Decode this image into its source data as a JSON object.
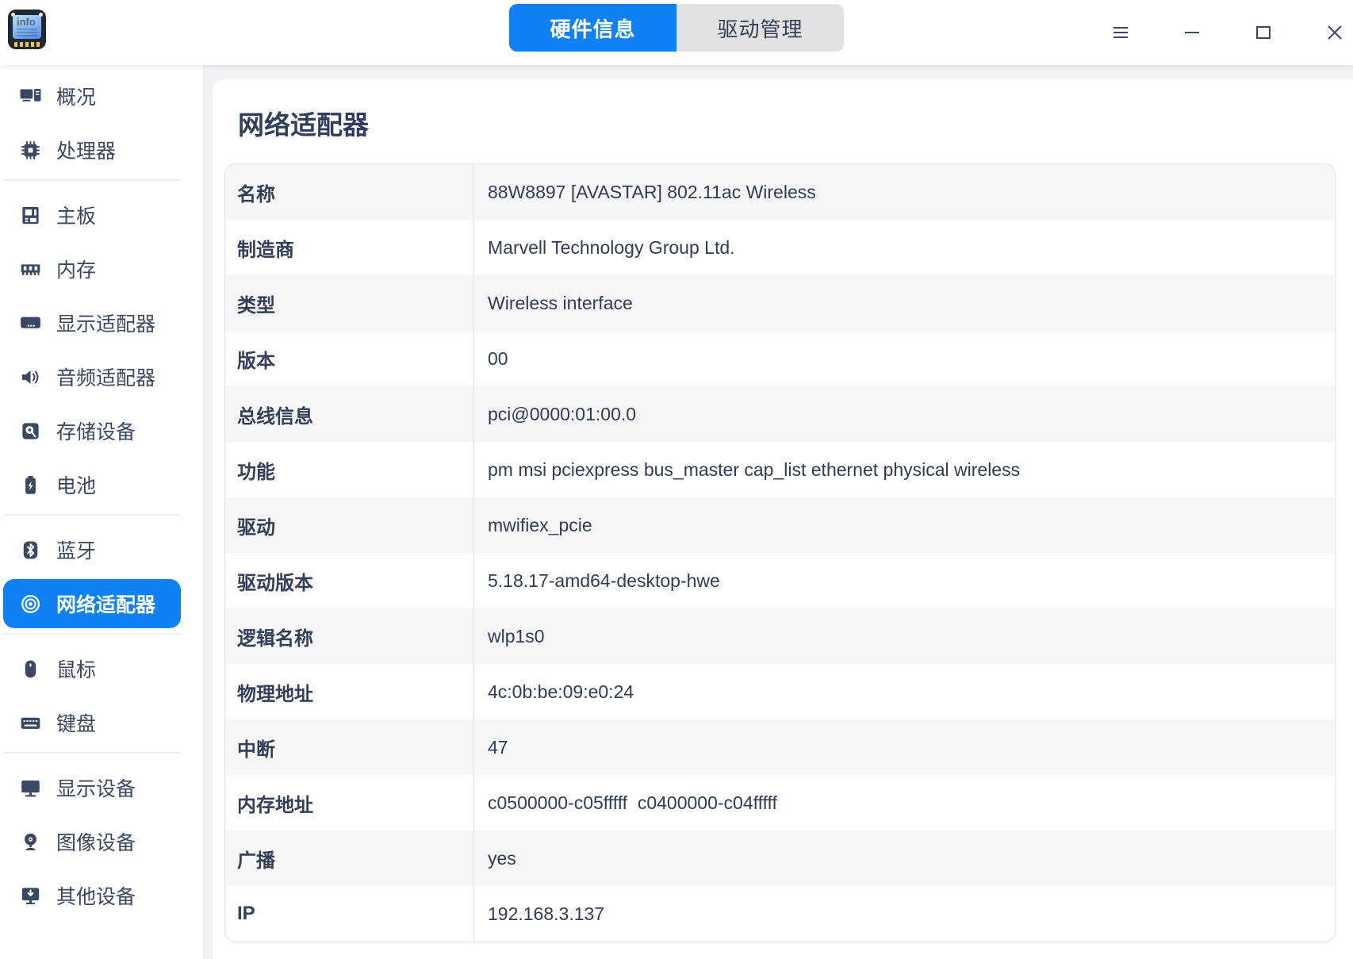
{
  "colors": {
    "accent": "#1081f5"
  },
  "app": {
    "logo_text": "info"
  },
  "tabs": [
    {
      "label": "硬件信息",
      "active": true
    },
    {
      "label": "驱动管理",
      "active": false
    }
  ],
  "window_controls": [
    {
      "icon": "menu-icon"
    },
    {
      "icon": "minimize-icon"
    },
    {
      "icon": "maximize-icon"
    },
    {
      "icon": "close-icon"
    }
  ],
  "sidebar": {
    "groups": [
      {
        "items": [
          {
            "id": "overview",
            "icon": "overview-icon",
            "label": "概况"
          },
          {
            "id": "cpu",
            "icon": "cpu-icon",
            "label": "处理器"
          }
        ]
      },
      {
        "items": [
          {
            "id": "motherboard",
            "icon": "motherboard-icon",
            "label": "主板"
          },
          {
            "id": "memory",
            "icon": "memory-icon",
            "label": "内存"
          },
          {
            "id": "display-adapter",
            "icon": "display-adapter-icon",
            "label": "显示适配器"
          },
          {
            "id": "audio-adapter",
            "icon": "audio-icon",
            "label": "音频适配器"
          },
          {
            "id": "storage",
            "icon": "storage-icon",
            "label": "存储设备"
          },
          {
            "id": "battery",
            "icon": "battery-icon",
            "label": "电池"
          }
        ]
      },
      {
        "items": [
          {
            "id": "bluetooth",
            "icon": "bluetooth-icon",
            "label": "蓝牙"
          },
          {
            "id": "network-adapter",
            "icon": "network-icon",
            "label": "网络适配器",
            "selected": true
          }
        ]
      },
      {
        "items": [
          {
            "id": "mouse",
            "icon": "mouse-icon",
            "label": "鼠标"
          },
          {
            "id": "keyboard",
            "icon": "keyboard-icon",
            "label": "键盘"
          }
        ]
      },
      {
        "items": [
          {
            "id": "display-device",
            "icon": "display-device-icon",
            "label": "显示设备"
          },
          {
            "id": "image-device",
            "icon": "image-device-icon",
            "label": "图像设备"
          },
          {
            "id": "other-device",
            "icon": "other-device-icon",
            "label": "其他设备"
          }
        ]
      }
    ]
  },
  "main": {
    "title": "网络适配器",
    "table": {
      "rows": [
        {
          "label": "名称",
          "value": "88W8897 [AVASTAR] 802.11ac Wireless"
        },
        {
          "label": "制造商",
          "value": "Marvell Technology Group Ltd."
        },
        {
          "label": "类型",
          "value": "Wireless interface"
        },
        {
          "label": "版本",
          "value": "00"
        },
        {
          "label": "总线信息",
          "value": "pci@0000:01:00.0"
        },
        {
          "label": "功能",
          "value": "pm msi pciexpress bus_master cap_list ethernet physical wireless"
        },
        {
          "label": "驱动",
          "value": "mwifiex_pcie"
        },
        {
          "label": "驱动版本",
          "value": "5.18.17-amd64-desktop-hwe"
        },
        {
          "label": "逻辑名称",
          "value": "wlp1s0"
        },
        {
          "label": "物理地址",
          "value": "4c:0b:be:09:e0:24"
        },
        {
          "label": "中断",
          "value": "47"
        },
        {
          "label": "内存地址",
          "value": "c0500000-c05fffff  c0400000-c04fffff"
        },
        {
          "label": "广播",
          "value": "yes"
        },
        {
          "label": "IP",
          "value": "192.168.3.137"
        }
      ]
    }
  }
}
